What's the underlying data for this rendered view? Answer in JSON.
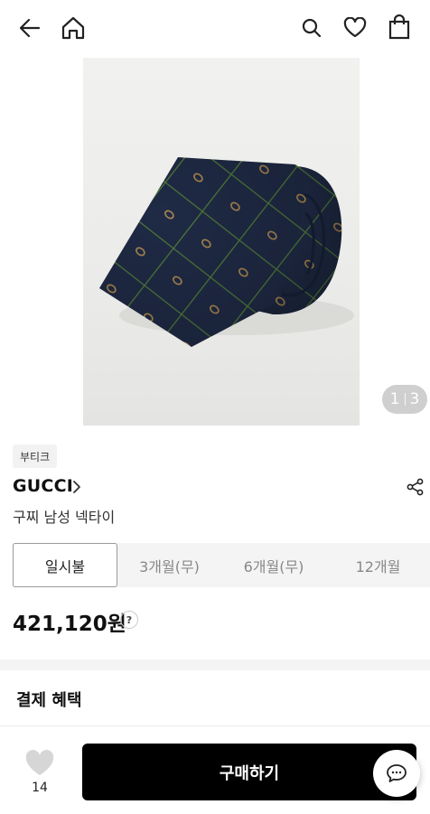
{
  "header": {
    "icons": [
      "back-arrow-icon",
      "home-icon",
      "search-icon",
      "heart-icon",
      "shopping-bag-icon"
    ]
  },
  "gallery": {
    "current": "1",
    "total": "3"
  },
  "product": {
    "badge": "부티크",
    "brand": "GUCCI",
    "name": "구찌 남성 넥타이",
    "price": "421,120원",
    "help_label": "?"
  },
  "installment_tabs": [
    {
      "label": "일시불",
      "active": true
    },
    {
      "label": "3개월(무)",
      "active": false
    },
    {
      "label": "6개월(무)",
      "active": false
    },
    {
      "label": "12개월",
      "active": false
    }
  ],
  "benefits": {
    "title": "결제 혜택"
  },
  "bottom_bar": {
    "like_count": "14",
    "buy_label": "구매하기"
  },
  "colors": {
    "accent": "#000000",
    "tie_navy": "#1f2a45",
    "tie_stripe": "#4f7a3a",
    "tie_logo": "#b08a52"
  }
}
